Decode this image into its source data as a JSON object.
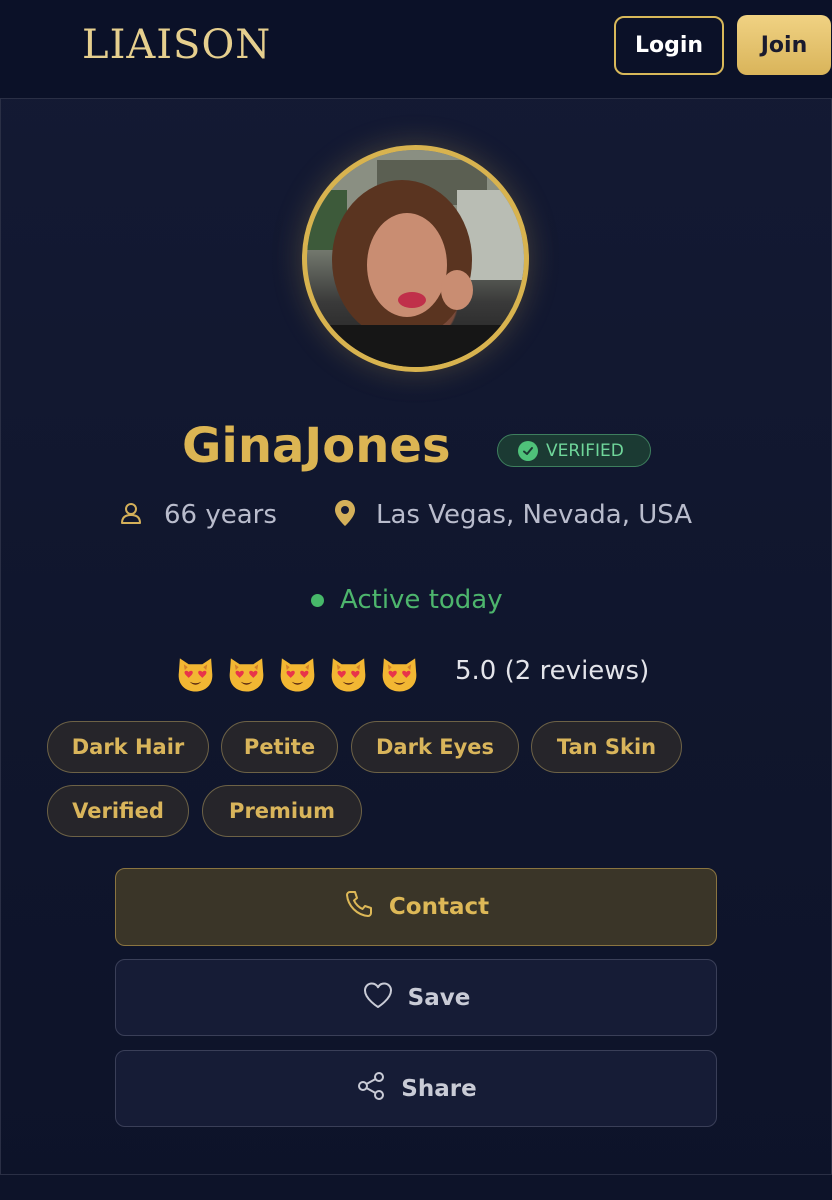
{
  "header": {
    "logo": "LIAISON",
    "login_label": "Login",
    "join_label": "Join"
  },
  "profile": {
    "name": "GinaJones",
    "verified_badge": "VERIFIED",
    "age": "66 years",
    "location": "Las Vegas, Nevada, USA",
    "status": "Active today",
    "rating_icons": [
      "heart-eyes-cat-icon",
      "heart-eyes-cat-icon",
      "heart-eyes-cat-icon",
      "heart-eyes-cat-icon",
      "heart-eyes-cat-icon"
    ],
    "rating_text": "5.0 (2 reviews)"
  },
  "tags": [
    "Dark Hair",
    "Petite",
    "Dark Eyes",
    "Tan Skin",
    "Verified",
    "Premium"
  ],
  "actions": {
    "contact_label": "Contact",
    "save_label": "Save",
    "share_label": "Share"
  },
  "colors": {
    "accent_gold": "#dcb553",
    "background": "#10162d",
    "active_green": "#4db56d",
    "verified_green": "#6fd69a"
  }
}
